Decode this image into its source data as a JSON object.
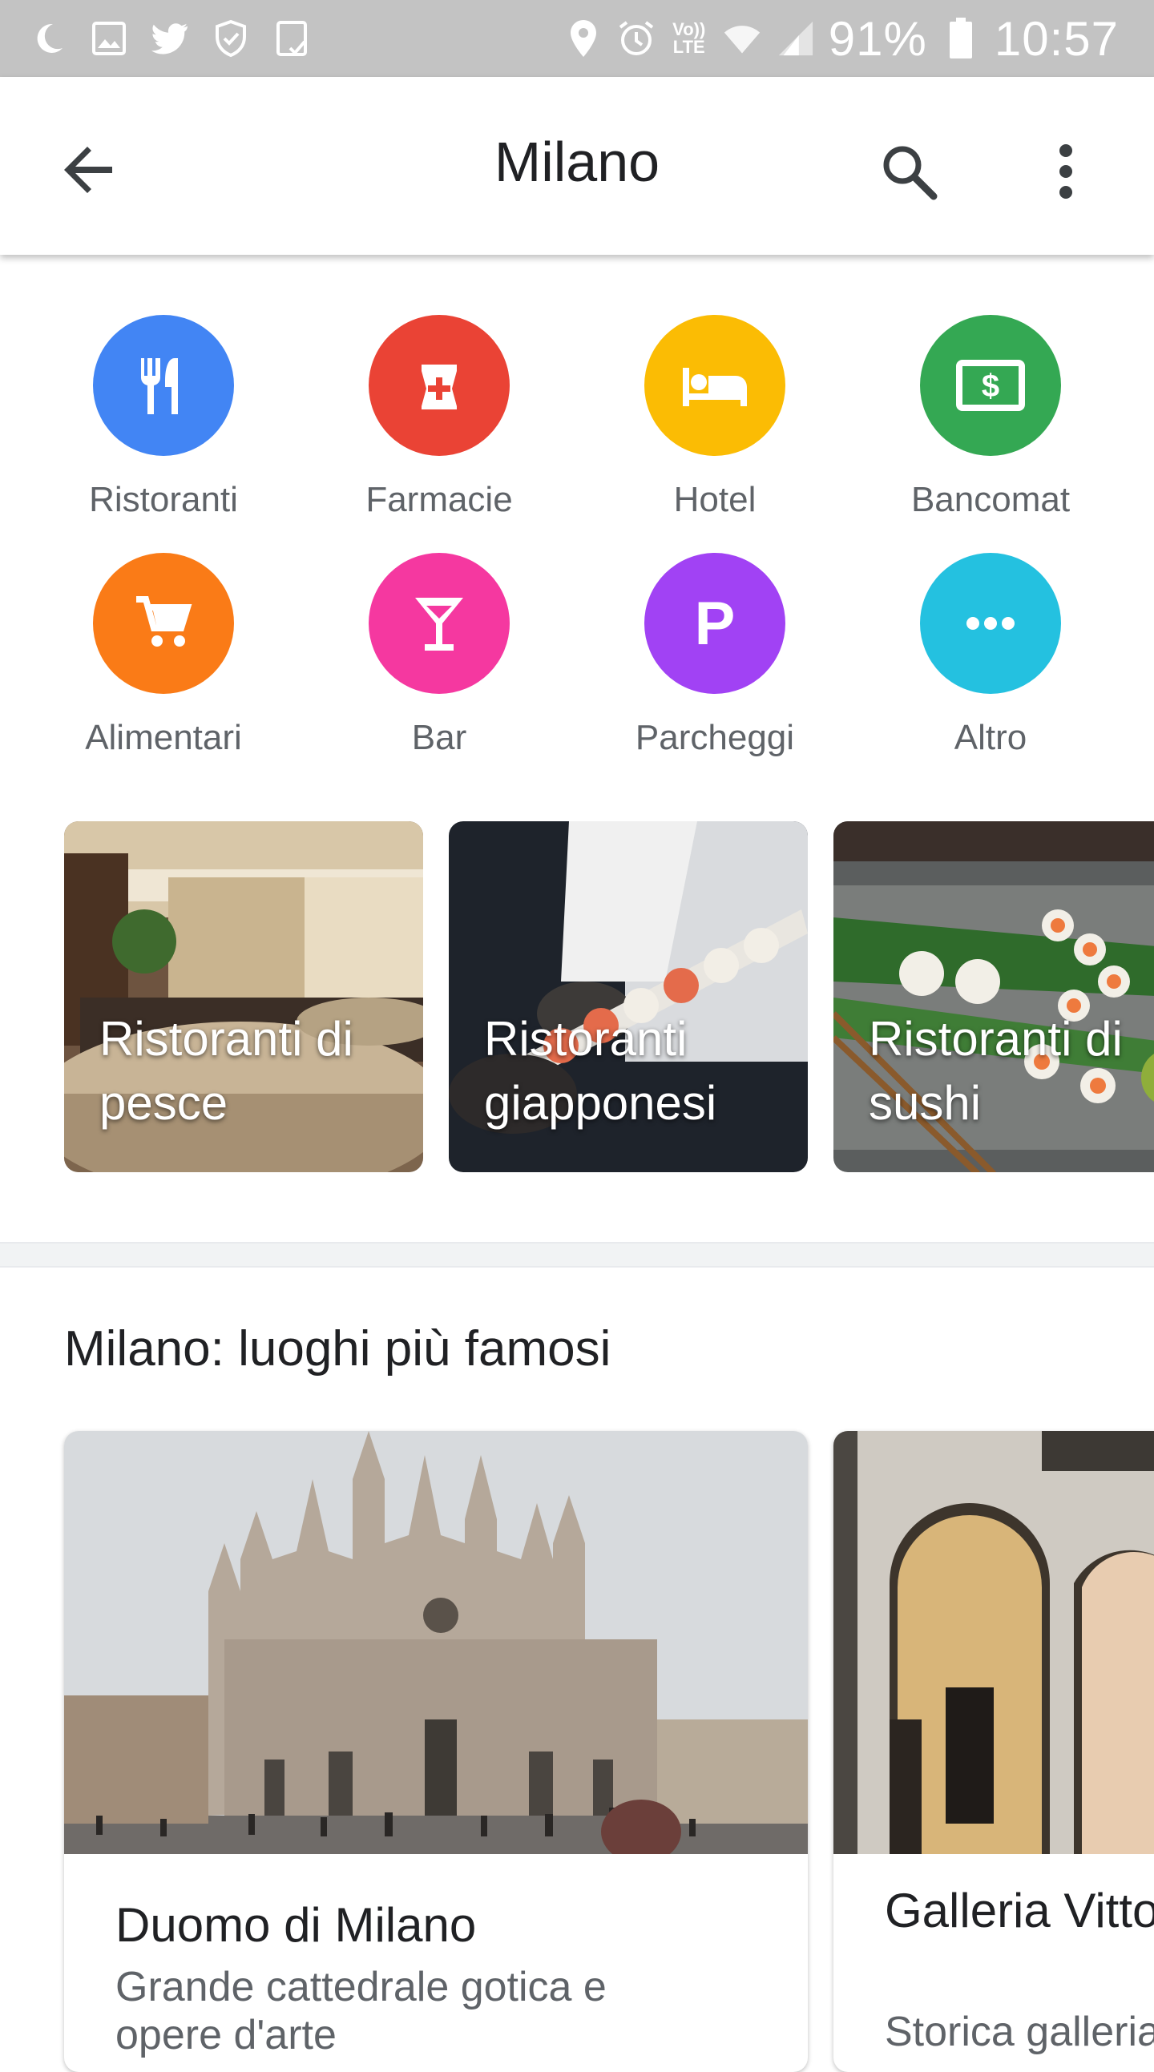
{
  "status_bar": {
    "battery": "91%",
    "time": "10:57",
    "network_badge": "Vo)) LTE"
  },
  "app_bar": {
    "title": "Milano"
  },
  "categories": [
    {
      "label": "Ristoranti",
      "color": "#4285f4",
      "icon": "restaurant-icon"
    },
    {
      "label": "Farmacie",
      "color": "#ea4335",
      "icon": "pharmacy-icon"
    },
    {
      "label": "Hotel",
      "color": "#fbbc04",
      "icon": "hotel-bed-icon"
    },
    {
      "label": "Bancomat",
      "color": "#34a853",
      "icon": "atm-icon"
    },
    {
      "label": "Alimentari",
      "color": "#fa7b17",
      "icon": "cart-icon"
    },
    {
      "label": "Bar",
      "color": "#f538a0",
      "icon": "cocktail-icon"
    },
    {
      "label": "Parcheggi",
      "color": "#a142f4",
      "icon": "parking-icon"
    },
    {
      "label": "Altro",
      "color": "#24c1e0",
      "icon": "more-horiz-icon"
    }
  ],
  "recommendations": [
    {
      "label": "Ristoranti di pesce"
    },
    {
      "label": "Ristoranti giapponesi"
    },
    {
      "label": "Ristoranti di sushi"
    }
  ],
  "famous_places": {
    "title": "Milano: luoghi più famosi",
    "items": [
      {
        "name": "Duomo di Milano",
        "description": "Grande cattedrale gotica e opere d'arte"
      },
      {
        "name": "Galleria Vittorio Emanuele II",
        "description": "Storica galleria"
      }
    ]
  }
}
